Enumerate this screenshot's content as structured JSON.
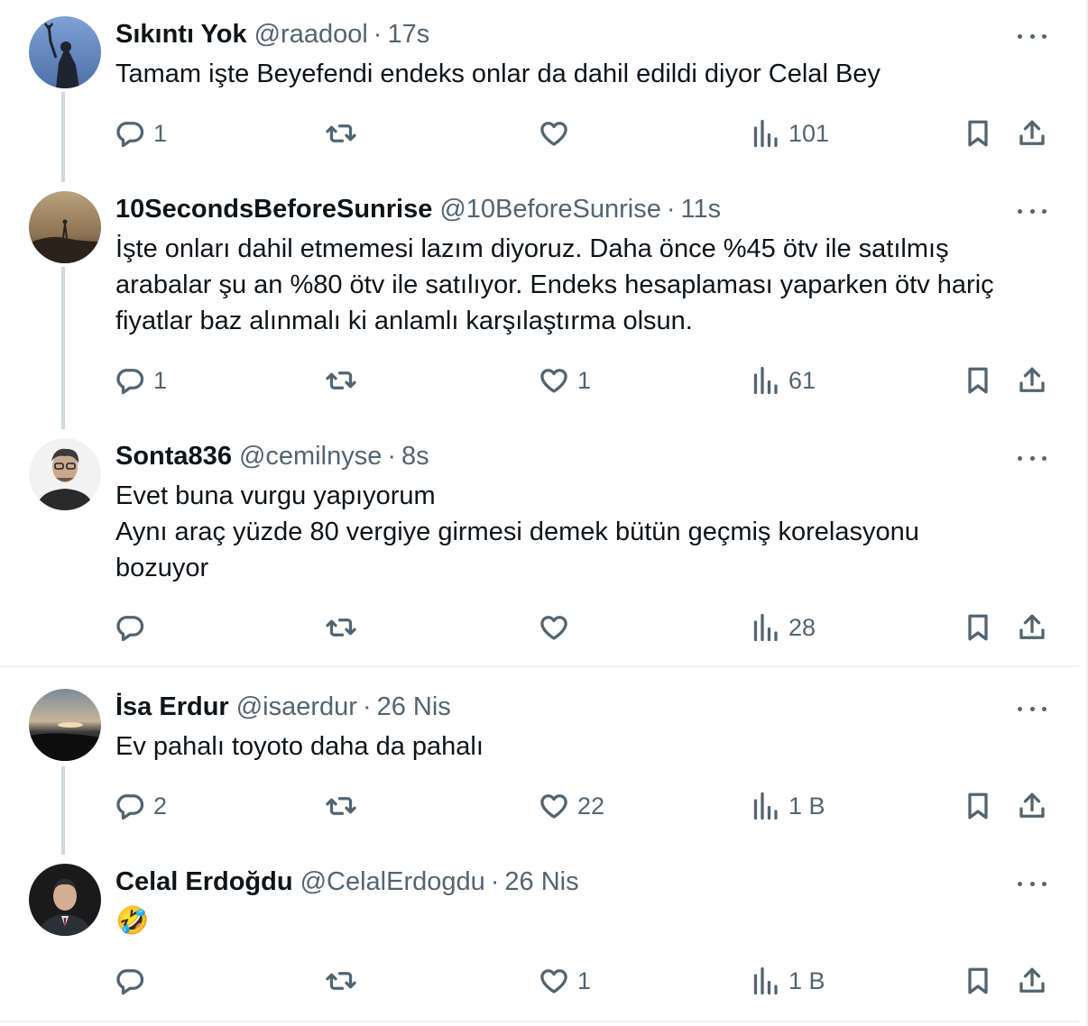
{
  "tweets": [
    {
      "name": "Sıkıntı Yok",
      "handle": "@raadool",
      "sep": "·",
      "time": "17s",
      "text": [
        "Tamam işte Beyefendi endeks onlar da dahil edildi diyor Celal Bey"
      ],
      "reply": "1",
      "retweet": "",
      "like": "",
      "views": "101"
    },
    {
      "name": "10SecondsBeforeSunrise",
      "handle": "@10BeforeSunrise",
      "sep": "·",
      "time": "11s",
      "text": [
        "İşte onları dahil etmemesi lazım diyoruz. Daha önce %45 ötv ile satılmış",
        "arabalar şu an %80 ötv ile satılıyor. Endeks hesaplaması yaparken ötv hariç",
        "fiyatlar baz alınmalı ki anlamlı karşılaştırma olsun."
      ],
      "reply": "1",
      "retweet": "",
      "like": "1",
      "views": "61"
    },
    {
      "name": "Sonta836",
      "handle": "@cemilnyse",
      "sep": "·",
      "time": "8s",
      "text": [
        "Evet buna vurgu yapıyorum",
        "Aynı araç yüzde 80 vergiye girmesi demek bütün geçmiş korelasyonu",
        "bozuyor"
      ],
      "reply": "",
      "retweet": "",
      "like": "",
      "views": "28"
    },
    {
      "name": "İsa Erdur",
      "handle": "@isaerdur",
      "sep": "·",
      "time": "26 Nis",
      "text": [
        "Ev pahalı toyoto daha da pahalı"
      ],
      "reply": "2",
      "retweet": "",
      "like": "22",
      "views": "1 B"
    },
    {
      "name": "Celal Erdoğdu",
      "handle": "@CelalErdogdu",
      "sep": "·",
      "time": "26 Nis",
      "text": [
        "🤣"
      ],
      "reply": "",
      "retweet": "",
      "like": "1",
      "views": "1 B"
    }
  ],
  "icons": {
    "reply": "reply-icon",
    "retweet": "retweet-icon",
    "like": "heart-icon",
    "views": "views-icon",
    "bookmark": "bookmark-icon",
    "share": "share-icon",
    "more": "more-icon"
  },
  "colors": {
    "text": "#0f1419",
    "secondary": "#536471",
    "thread_line": "#cfd9de",
    "divider": "#eff3f4"
  }
}
